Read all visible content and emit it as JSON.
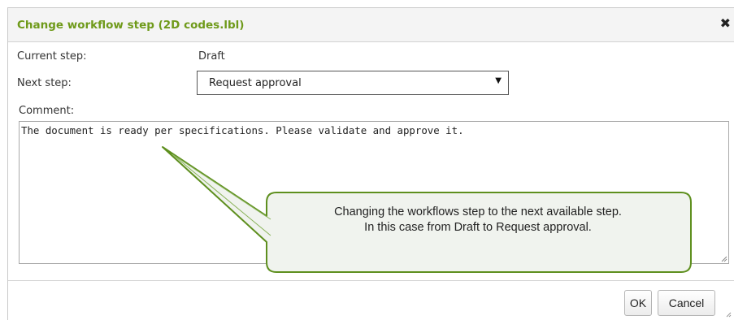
{
  "dialog": {
    "title": "Change workflow step (2D codes.lbl)",
    "close_icon": "close-icon",
    "current_step_label": "Current step:",
    "current_step_value": "Draft",
    "next_step_label": "Next step:",
    "next_step_selected": "Request approval",
    "comment_label": "Comment:",
    "comment_value": "The document is ready per specifications. Please validate and approve it.",
    "ok_label": "OK",
    "cancel_label": "Cancel"
  },
  "callout": {
    "line1": "Changing the workflows step to the next available step.",
    "line2": "In this case from Draft to Request approval."
  },
  "colors": {
    "title": "#6f9a1a",
    "callout_border": "#5e8f1e",
    "callout_fill": "#f0f3ee"
  }
}
